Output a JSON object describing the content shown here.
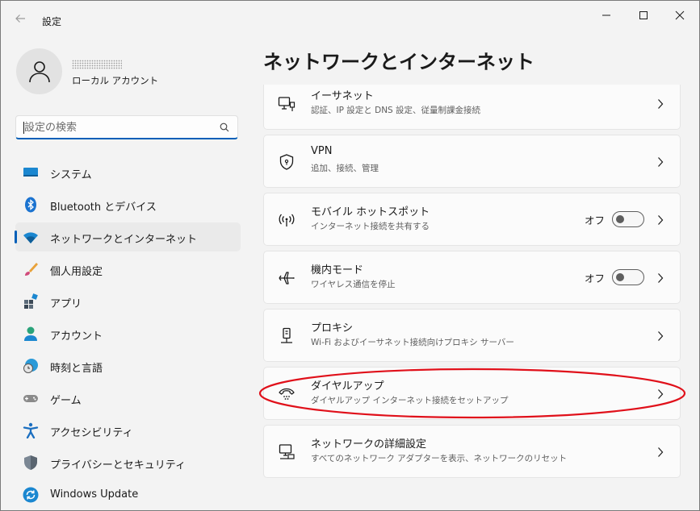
{
  "app": {
    "title": "設定"
  },
  "profile": {
    "account_type": "ローカル アカウント"
  },
  "search": {
    "placeholder": "設定の検索"
  },
  "nav": {
    "items": [
      {
        "label": "システム",
        "icon": "system-icon"
      },
      {
        "label": "Bluetooth とデバイス",
        "icon": "bluetooth-icon"
      },
      {
        "label": "ネットワークとインターネット",
        "icon": "wifi-icon",
        "active": true
      },
      {
        "label": "個人用設定",
        "icon": "brush-icon"
      },
      {
        "label": "アプリ",
        "icon": "apps-icon"
      },
      {
        "label": "アカウント",
        "icon": "person-icon"
      },
      {
        "label": "時刻と言語",
        "icon": "globe-clock-icon"
      },
      {
        "label": "ゲーム",
        "icon": "gamepad-icon"
      },
      {
        "label": "アクセシビリティ",
        "icon": "accessibility-icon"
      },
      {
        "label": "プライバシーとセキュリティ",
        "icon": "shield-icon"
      },
      {
        "label": "Windows Update",
        "icon": "sync-icon"
      }
    ]
  },
  "main": {
    "title": "ネットワークとインターネット",
    "cards": [
      {
        "title": "イーサネット",
        "subtitle": "認証、IP 設定と DNS 設定、従量制課金接続",
        "icon": "ethernet-icon"
      },
      {
        "title": "VPN",
        "subtitle": "追加、接続、管理",
        "icon": "vpn-shield-icon"
      },
      {
        "title": "モバイル ホットスポット",
        "subtitle": "インターネット接続を共有する",
        "icon": "hotspot-icon",
        "toggle": {
          "label": "オフ",
          "on": false
        }
      },
      {
        "title": "機内モード",
        "subtitle": "ワイヤレス通信を停止",
        "icon": "airplane-icon",
        "toggle": {
          "label": "オフ",
          "on": false
        }
      },
      {
        "title": "プロキシ",
        "subtitle": "Wi-Fi およびイーサネット接続向けプロキシ サーバー",
        "icon": "proxy-icon"
      },
      {
        "title": "ダイヤルアップ",
        "subtitle": "ダイヤルアップ インターネット接続をセットアップ",
        "icon": "dialup-phone-icon"
      },
      {
        "title": "ネットワークの詳細設定",
        "subtitle": "すべてのネットワーク アダプターを表示、ネットワークのリセット",
        "icon": "network-pc-icon"
      }
    ]
  },
  "colors": {
    "accent": "#005fb8",
    "annotation": "#e0101a"
  }
}
